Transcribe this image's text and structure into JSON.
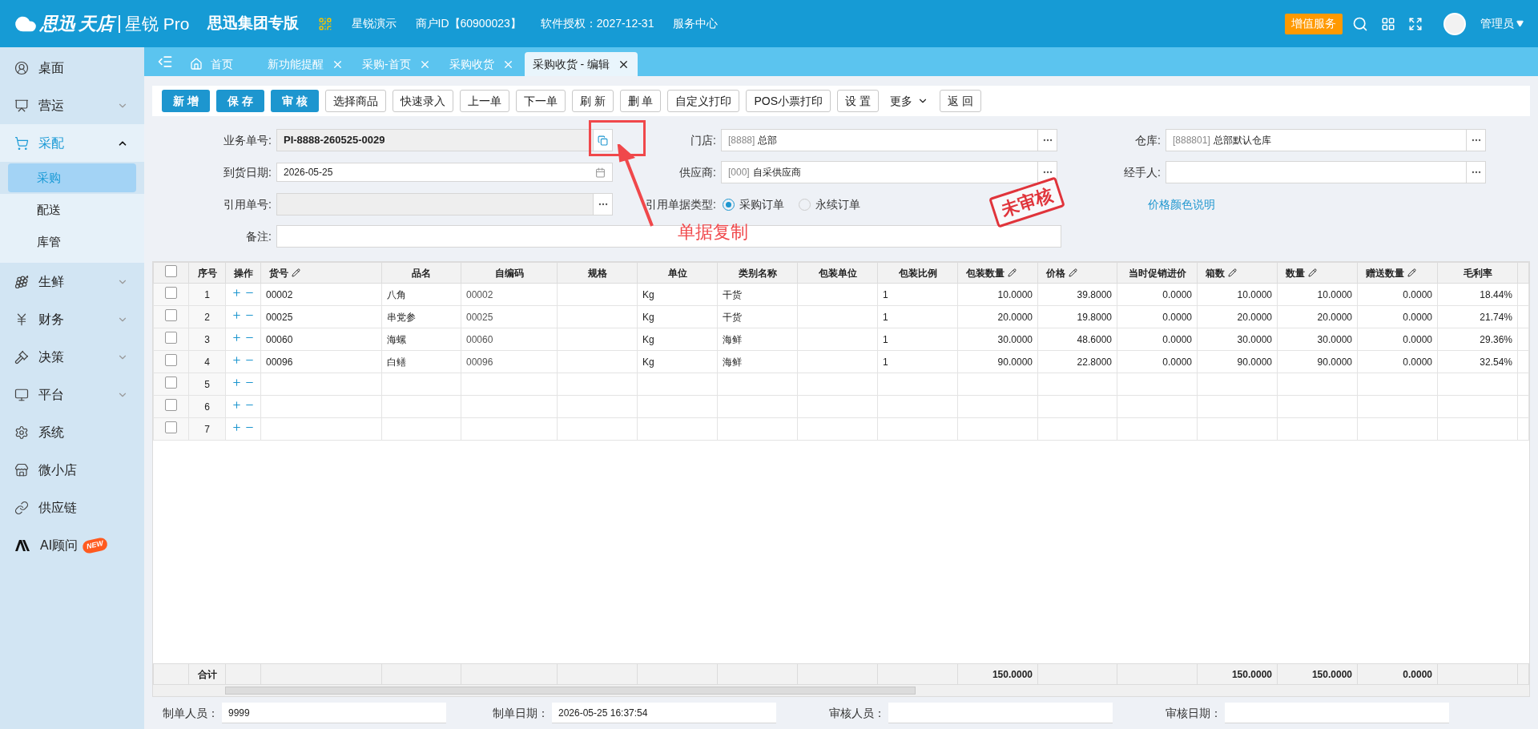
{
  "header": {
    "brand": [
      "思迅",
      "天店",
      "星锐 Pro"
    ],
    "edition": "思迅集团专版",
    "links": [
      "星锐演示",
      "商户ID【60900023】",
      "软件授权：2027-12-31",
      "服务中心"
    ],
    "service_button": "增值服务",
    "user": "管理员"
  },
  "sidebar": {
    "items": [
      {
        "label": "桌面",
        "selected": false
      },
      {
        "label": "营运",
        "selected": false,
        "expanded": false
      },
      {
        "label": "采配",
        "selected": true,
        "expanded": true,
        "children": [
          {
            "label": "采购",
            "selected": true
          },
          {
            "label": "配送",
            "selected": false
          },
          {
            "label": "库管",
            "selected": false
          }
        ]
      },
      {
        "label": "生鲜",
        "selected": false,
        "expanded": false
      },
      {
        "label": "财务",
        "selected": false,
        "expanded": false
      },
      {
        "label": "决策",
        "selected": false,
        "expanded": false
      },
      {
        "label": "平台",
        "selected": false,
        "expanded": false
      },
      {
        "label": "系统",
        "selected": false
      },
      {
        "label": "微小店",
        "selected": false
      },
      {
        "label": "供应链",
        "selected": false
      },
      {
        "label": "AI顾问",
        "selected": false,
        "badge": "NEW"
      }
    ]
  },
  "tabs": [
    {
      "label": "首页",
      "selected": false,
      "kind": "home"
    },
    {
      "label": "新功能提醒",
      "selected": false,
      "kind": "closable"
    },
    {
      "label": "采购-首页",
      "selected": false,
      "kind": "closable"
    },
    {
      "label": "采购收货",
      "selected": false,
      "kind": "closable"
    },
    {
      "label": "采购收货 - 编辑",
      "selected": true,
      "kind": "closable"
    }
  ],
  "toolbar": [
    {
      "label": "新 增",
      "kind": "primary"
    },
    {
      "label": "保 存",
      "kind": "primary"
    },
    {
      "label": "审 核",
      "kind": "primary"
    },
    {
      "label": "选择商品",
      "kind": "plain"
    },
    {
      "label": "快速录入",
      "kind": "plain"
    },
    {
      "label": "上一单",
      "kind": "plain"
    },
    {
      "label": "下一单",
      "kind": "plain"
    },
    {
      "label": "刷 新",
      "kind": "plain"
    },
    {
      "label": "删 单",
      "kind": "plain"
    },
    {
      "label": "自定义打印",
      "kind": "plain"
    },
    {
      "label": "POS小票打印",
      "kind": "plain"
    },
    {
      "label": "设 置",
      "kind": "plain"
    },
    {
      "label": "更多",
      "kind": "menu"
    },
    {
      "label": "返 回",
      "kind": "plain"
    }
  ],
  "form": {
    "doc_no": {
      "label": "业务单号:",
      "value": "PI-8888-260525-0029"
    },
    "store": {
      "label": "门店:",
      "code": "[8888]",
      "name": "总部"
    },
    "warehouse": {
      "label": "仓库:",
      "code": "[888801]",
      "name": "总部默认仓库"
    },
    "arrival_date": {
      "label": "到货日期:",
      "value": "2026-05-25"
    },
    "supplier": {
      "label": "供应商:",
      "code": "[000]",
      "name": "自采供应商"
    },
    "handler": {
      "label": "经手人:"
    },
    "ref_no": {
      "label": "引用单号:",
      "disabled": true
    },
    "ref_type": {
      "label": "引用单据类型:",
      "options": [
        {
          "label": "采购订单",
          "selected": true
        },
        {
          "label": "永续订单",
          "selected": false
        }
      ]
    },
    "price_color_link": "价格颜色说明",
    "remark": {
      "label": "备注:"
    }
  },
  "status_stamp": "未审核",
  "annotation": {
    "text": "单据复制"
  },
  "table": {
    "header_checked": false,
    "columns": [
      {
        "label": "序号",
        "kind": "index"
      },
      {
        "label": "操作",
        "kind": "actions"
      },
      {
        "label": "货号",
        "editable": true,
        "kind": "text"
      },
      {
        "label": "品名",
        "kind": "text"
      },
      {
        "label": "自编码",
        "kind": "text"
      },
      {
        "label": "规格",
        "kind": "text"
      },
      {
        "label": "单位",
        "kind": "text"
      },
      {
        "label": "类别名称",
        "kind": "text"
      },
      {
        "label": "包装单位",
        "kind": "text"
      },
      {
        "label": "包装比例",
        "kind": "text"
      },
      {
        "label": "包装数量",
        "editable": true,
        "kind": "number",
        "total": "150.0000"
      },
      {
        "label": "价格",
        "editable": true,
        "kind": "number"
      },
      {
        "label": "当时促销进价",
        "kind": "number"
      },
      {
        "label": "箱数",
        "editable": true,
        "kind": "number",
        "total": "150.0000"
      },
      {
        "label": "数量",
        "editable": true,
        "kind": "number",
        "total": "150.0000"
      },
      {
        "label": "赠送数量",
        "editable": true,
        "kind": "number",
        "total": "0.0000"
      },
      {
        "label": "毛利率",
        "kind": "number"
      }
    ],
    "rows": [
      {
        "checked": false,
        "cells": [
          "1",
          null,
          "00002",
          "八角",
          "00002",
          null,
          "Kg",
          "干货",
          null,
          "1",
          "10.0000",
          "39.8000",
          "0.0000",
          "10.0000",
          "10.0000",
          "0.0000",
          "18.44%"
        ]
      },
      {
        "checked": false,
        "cells": [
          "2",
          null,
          "00025",
          "串党参",
          "00025",
          null,
          "Kg",
          "干货",
          null,
          "1",
          "20.0000",
          "19.8000",
          "0.0000",
          "20.0000",
          "20.0000",
          "0.0000",
          "21.74%"
        ]
      },
      {
        "checked": false,
        "cells": [
          "3",
          null,
          "00060",
          "海螺",
          "00060",
          null,
          "Kg",
          "海鲜",
          null,
          "1",
          "30.0000",
          "48.6000",
          "0.0000",
          "30.0000",
          "30.0000",
          "0.0000",
          "29.36%"
        ]
      },
      {
        "checked": false,
        "cells": [
          "4",
          null,
          "00096",
          "白鳝",
          "00096",
          null,
          "Kg",
          "海鲜",
          null,
          "1",
          "90.0000",
          "22.8000",
          "0.0000",
          "90.0000",
          "90.0000",
          "0.0000",
          "32.54%"
        ]
      },
      {
        "checked": false,
        "cells": [
          "5"
        ]
      },
      {
        "checked": false,
        "cells": [
          "6"
        ]
      },
      {
        "checked": false,
        "cells": [
          "7"
        ]
      }
    ],
    "totals_label": "合计"
  },
  "footer": [
    {
      "label": "制单人员：",
      "value": "9999"
    },
    {
      "label": "制单日期：",
      "value": "2026-05-25 16:37:54"
    },
    {
      "label": "审核人员："
    },
    {
      "label": "审核日期："
    }
  ]
}
